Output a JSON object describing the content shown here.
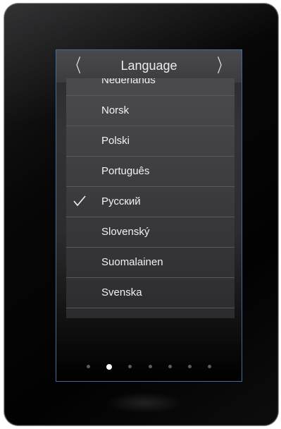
{
  "header": {
    "title": "Language",
    "prev_label": "〈",
    "next_label": "〉"
  },
  "languages": [
    {
      "label": "Nederlands",
      "selected": false
    },
    {
      "label": "Norsk",
      "selected": false
    },
    {
      "label": "Polski",
      "selected": false
    },
    {
      "label": "Português",
      "selected": false
    },
    {
      "label": "Pусский",
      "selected": true
    },
    {
      "label": "Slovenský",
      "selected": false
    },
    {
      "label": "Suomalainen",
      "selected": false
    },
    {
      "label": "Svenska",
      "selected": false
    }
  ],
  "pagination": {
    "page_count": 7,
    "active_page": 2
  },
  "colors": {
    "screen_border": "#3f6f9e",
    "text": "#f2f2f2",
    "dot_active": "#ffffff",
    "dot_inactive": "#5c5c5e"
  },
  "icons": {
    "prev": "chevron-left-icon",
    "next": "chevron-right-icon",
    "selected": "checkmark-icon"
  }
}
